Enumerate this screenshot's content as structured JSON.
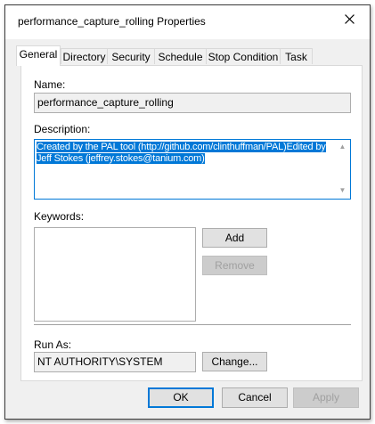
{
  "window": {
    "title": "performance_capture_rolling Properties"
  },
  "tabs": [
    {
      "label": "General",
      "active": true
    },
    {
      "label": "Directory"
    },
    {
      "label": "Security"
    },
    {
      "label": "Schedule"
    },
    {
      "label": "Stop Condition"
    },
    {
      "label": "Task"
    }
  ],
  "general": {
    "name_label": "Name:",
    "name_value": "performance_capture_rolling",
    "description_label": "Description:",
    "description_value": "Created by the PAL tool (http://github.com/clinthuffman/PAL)Edited by Jeff Stokes (jeffrey.stokes@tanium.com)",
    "keywords_label": "Keywords:",
    "add_label": "Add",
    "remove_label": "Remove",
    "run_as_label": "Run As:",
    "run_as_value": "NT AUTHORITY\\SYSTEM",
    "change_label": "Change..."
  },
  "footer": {
    "ok_label": "OK",
    "cancel_label": "Cancel",
    "apply_label": "Apply"
  },
  "colors": {
    "accent": "#0078d7",
    "window_bg": "#f0f0f0"
  },
  "icons": {
    "close": "close-icon",
    "scroll_up": "scroll-up-arrow-icon",
    "scroll_down": "scroll-down-arrow-icon"
  }
}
